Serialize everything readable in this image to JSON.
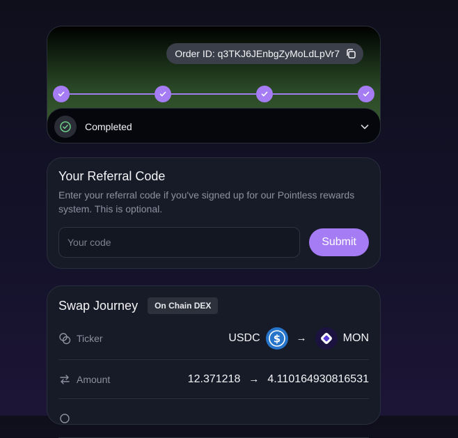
{
  "order": {
    "label": "Order ID: q3TKJ6JEnbgZyMoLdLpVr7",
    "copy_icon": "copy-icon"
  },
  "progress": {
    "steps_completed": 4,
    "steps_total": 4,
    "accent": "#a67cf4"
  },
  "status": {
    "label": "Completed",
    "icon": "check-circle-icon"
  },
  "referral": {
    "title": "Your Referral Code",
    "description": "Enter your referral code if you've signed up for our Pointless rewards system. This is optional.",
    "input_placeholder": "Your code",
    "input_value": "",
    "submit_label": "Submit"
  },
  "swap": {
    "title": "Swap Journey",
    "tag": "On Chain DEX",
    "ticker": {
      "label": "Ticker",
      "from": "USDC",
      "to": "MON"
    },
    "amount": {
      "label": "Amount",
      "from": "12.371218",
      "to": "4.110164930816531"
    }
  }
}
